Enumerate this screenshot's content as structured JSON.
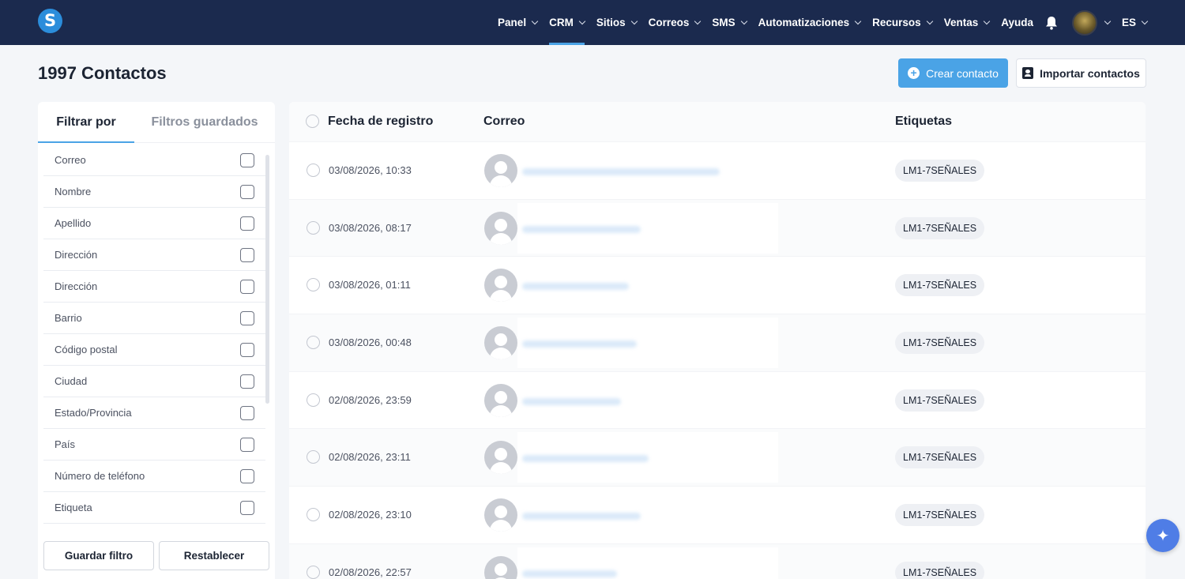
{
  "brand": {
    "logo_letter": "S"
  },
  "nav": {
    "items": [
      {
        "label": "Panel",
        "has_dropdown": true
      },
      {
        "label": "CRM",
        "has_dropdown": true,
        "active": true
      },
      {
        "label": "Sitios",
        "has_dropdown": true
      },
      {
        "label": "Correos",
        "has_dropdown": true
      },
      {
        "label": "SMS",
        "has_dropdown": true
      },
      {
        "label": "Automatizaciones",
        "has_dropdown": true
      },
      {
        "label": "Recursos",
        "has_dropdown": true
      },
      {
        "label": "Ventas",
        "has_dropdown": true
      },
      {
        "label": "Ayuda",
        "has_dropdown": false
      }
    ],
    "language": "ES",
    "icons": {
      "notifications": "bell-icon",
      "account": "avatar"
    }
  },
  "header": {
    "title": "1997 Contactos",
    "create_button": "Crear contacto",
    "import_button": "Importar contactos"
  },
  "filters": {
    "tabs": [
      "Filtrar por",
      "Filtros guardados"
    ],
    "active_tab": "Filtrar por",
    "fields": [
      "Correo",
      "Nombre",
      "Apellido",
      "Dirección",
      "Dirección",
      "Barrio",
      "Código postal",
      "Ciudad",
      "Estado/Provincia",
      "País",
      "Número de teléfono",
      "Etiqueta"
    ],
    "save_button": "Guardar filtro",
    "reset_button": "Restablecer"
  },
  "table": {
    "columns": [
      "Fecha de registro",
      "Correo",
      "Etiquetas"
    ],
    "rows": [
      {
        "date": "03/08/2026, 10:33",
        "tag": "LM1-7SEÑALES"
      },
      {
        "date": "03/08/2026, 08:17",
        "tag": "LM1-7SEÑALES"
      },
      {
        "date": "03/08/2026, 01:11",
        "tag": "LM1-7SEÑALES"
      },
      {
        "date": "03/08/2026, 00:48",
        "tag": "LM1-7SEÑALES"
      },
      {
        "date": "02/08/2026, 23:59",
        "tag": "LM1-7SEÑALES"
      },
      {
        "date": "02/08/2026, 23:11",
        "tag": "LM1-7SEÑALES"
      },
      {
        "date": "02/08/2026, 23:10",
        "tag": "LM1-7SEÑALES"
      },
      {
        "date": "02/08/2026, 22:57",
        "tag": "LM1-7SEÑALES"
      }
    ]
  },
  "colors": {
    "topbar": "#1b2a4e",
    "accent": "#4aa3e6",
    "background": "#f4f6f9"
  },
  "assistant_icon": "sparkle-icon"
}
